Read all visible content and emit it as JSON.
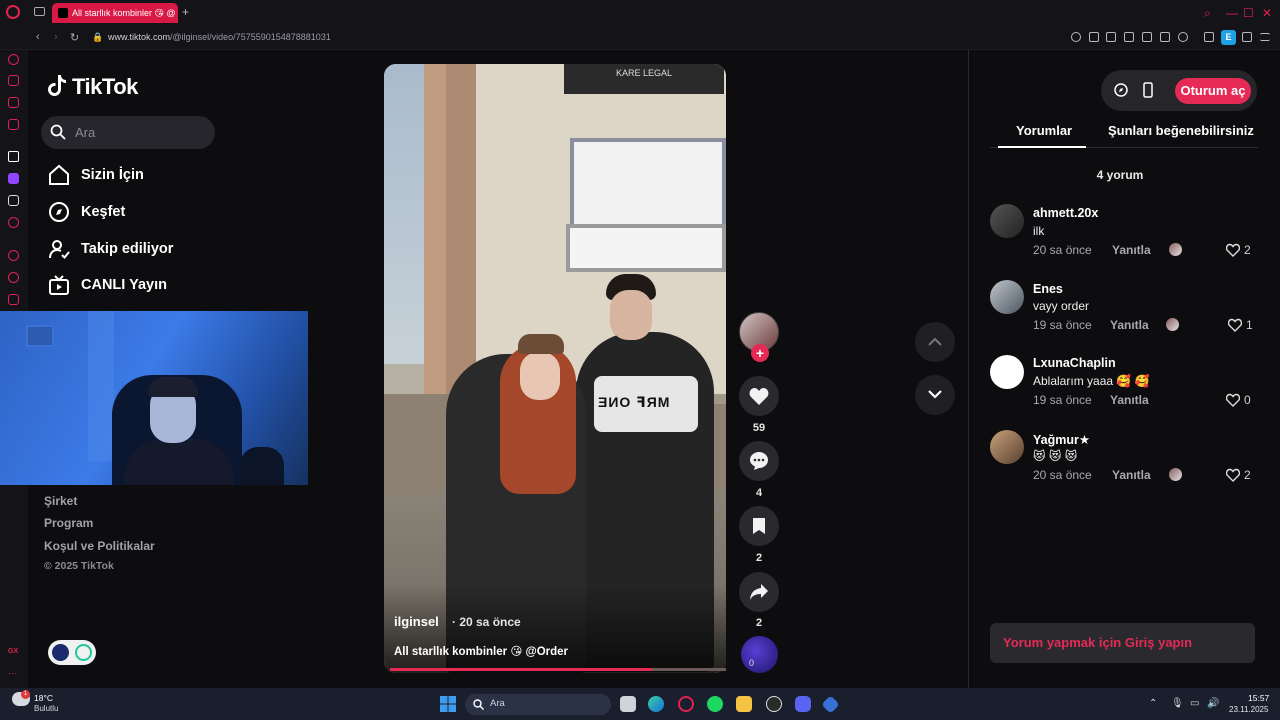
{
  "browser": {
    "tab_title": "All starllık kombinler 😘 @",
    "url_host": "www.tiktok.com",
    "url_path": "/@ilginsel/video/7575590154878881031",
    "extension_letter": "E"
  },
  "tiktok": {
    "logo": "TikTok",
    "search_placeholder": "Ara",
    "nav": [
      {
        "label": "Sizin İçin",
        "icon": "home-icon"
      },
      {
        "label": "Keşfet",
        "icon": "compass-icon"
      },
      {
        "label": "Takip ediliyor",
        "icon": "following-icon"
      },
      {
        "label": "CANLI Yayın",
        "icon": "live-tv-icon"
      }
    ],
    "footer": {
      "company": "Şirket",
      "program": "Program",
      "terms": "Koşul ve Politikalar",
      "copyright": "© 2025 TikTok"
    }
  },
  "video": {
    "author": "ilginsel",
    "posted": "· 20 sa önce",
    "description": "All starllık kombinler 😘 @Order",
    "jacket_text": "ƎИO ꟻЯM",
    "shop_sign": "KARE LEGAL",
    "progress": 0.78
  },
  "actions": {
    "likes": "59",
    "comments": "4",
    "saves": "2",
    "shares": "2",
    "disc_label": "0"
  },
  "panel": {
    "login_button": "Oturum aç",
    "tabs": [
      "Yorumlar",
      "Şunları beğenebilirsiniz"
    ],
    "comment_count": "4 yorum",
    "reply_label": "Yanıtla",
    "comment_login_prompt": "Yorum yapmak için Giriş yapın",
    "comments": [
      {
        "user": "ahmett.20x",
        "text": "ilk",
        "time": "20 sa önce",
        "likes": "2"
      },
      {
        "user": "Enes",
        "text": "vayy order",
        "time": "19 sa önce",
        "likes": "1"
      },
      {
        "user": "LxunaChaplin",
        "text": "Ablalarım yaaa 🥰 🥰",
        "time": "19 sa önce",
        "likes": "0"
      },
      {
        "user": "Yağmur★",
        "text": "😻 😻 😻",
        "time": "20 sa önce",
        "likes": "2"
      }
    ]
  },
  "taskbar": {
    "temp": "18°C",
    "condition": "Bulutlu",
    "weather_badge": "1",
    "search": "Ara",
    "time": "15:57",
    "date": "23.11.2025"
  },
  "colors": {
    "accent": "#e52a55",
    "opera_red": "#e0224f",
    "panel_bg": "#0d0d0f"
  }
}
